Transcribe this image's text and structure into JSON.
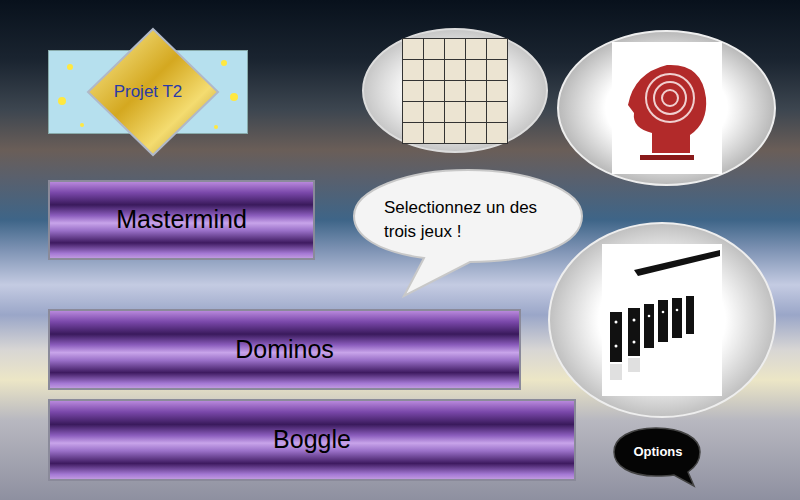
{
  "logo": {
    "text": "Projet T2"
  },
  "menu": [
    {
      "label": "Mastermind"
    },
    {
      "label": "Dominos"
    },
    {
      "label": "Boggle"
    }
  ],
  "bubble": {
    "text": "Selectionnez un des trois jeux !"
  },
  "options": {
    "label": "Options"
  }
}
